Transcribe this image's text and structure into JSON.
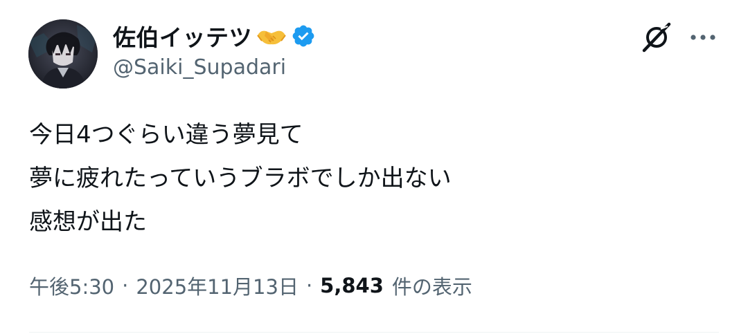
{
  "author": {
    "display_name": "佐伯イッテツ",
    "handle": "@Saiki_Supadari",
    "name_emoji": "handshake-emoji",
    "verified": true,
    "verified_color": "#1d9bf0"
  },
  "header_actions": {
    "grok_icon": "grok-icon",
    "more_icon": "more-horizontal-icon"
  },
  "tweet": {
    "lines": [
      "今日4つぐらい違う夢見て",
      "夢に疲れたっていうブラボでしか出ない",
      "感想が出た"
    ]
  },
  "meta": {
    "time": "午後5:30",
    "separator": "·",
    "date": "2025年11月13日",
    "views_count": "5,843",
    "views_label": "件の表示"
  },
  "colors": {
    "text_primary": "#0f1419",
    "text_secondary": "#536471",
    "divider": "#eff3f4"
  }
}
